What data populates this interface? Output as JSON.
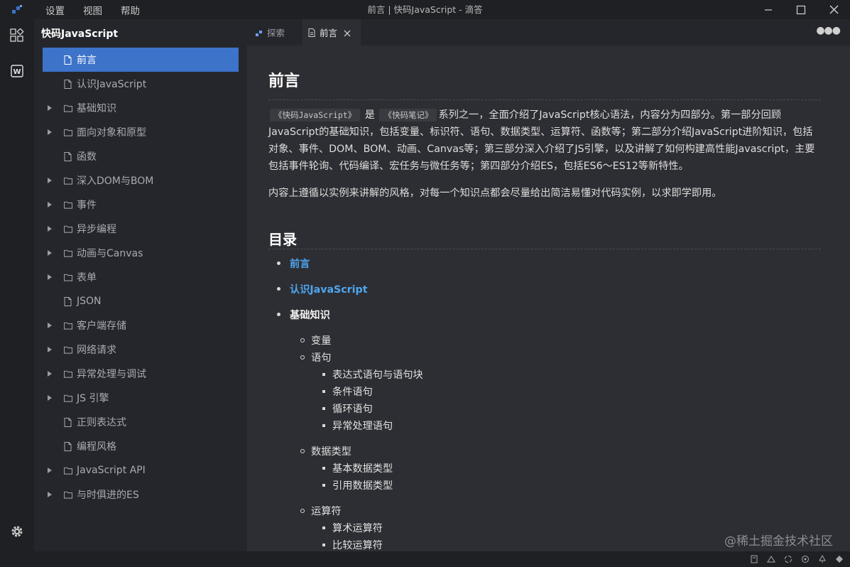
{
  "window": {
    "title": "前言 | 快码JavaScript - 滴答",
    "menu": [
      "设置",
      "视图",
      "帮助"
    ]
  },
  "sidebar": {
    "title": "快码JavaScript",
    "items": [
      {
        "label": "前言",
        "folder": false,
        "active": true
      },
      {
        "label": "认识JavaScript",
        "folder": false
      },
      {
        "label": "基础知识",
        "folder": true
      },
      {
        "label": "面向对象和原型",
        "folder": true
      },
      {
        "label": "函数",
        "folder": false
      },
      {
        "label": "深入DOM与BOM",
        "folder": true
      },
      {
        "label": "事件",
        "folder": true
      },
      {
        "label": "异步编程",
        "folder": true
      },
      {
        "label": "动画与Canvas",
        "folder": true
      },
      {
        "label": "表单",
        "folder": true
      },
      {
        "label": "JSON",
        "folder": false
      },
      {
        "label": "客户端存储",
        "folder": true
      },
      {
        "label": "网络请求",
        "folder": true
      },
      {
        "label": "异常处理与调试",
        "folder": true
      },
      {
        "label": "JS 引擎",
        "folder": true
      },
      {
        "label": "正则表达式",
        "folder": false
      },
      {
        "label": "编程风格",
        "folder": false
      },
      {
        "label": "JavaScript API",
        "folder": true
      },
      {
        "label": "与时俱进的ES",
        "folder": true
      }
    ]
  },
  "tabs": {
    "explore": "探索",
    "current": "前言"
  },
  "doc": {
    "title": "前言",
    "code1": "《快码JavaScript》",
    "is": "是",
    "code2": "《快码笔记》",
    "intro_rest": "系列之一，全面介绍了JavaScript核心语法，内容分为四部分。第一部分回顾JavaScript的基础知识，包括变量、标识符、语句、数据类型、运算符、函数等；第二部分介绍JavaScript进阶知识，包括对象、事件、DOM、BOM、动画、Canvas等；第三部分深入介绍了JS引擎，以及讲解了如何构建高性能Javascript，主要包括事件轮询、代码编译、宏任务与微任务等；第四部分介绍ES，包括ES6～ES12等新特性。",
    "para2": "内容上遵循以实例来讲解的风格，对每一个知识点都会尽量给出简洁易懂对代码实例，以求即学即用。",
    "toc_title": "目录",
    "toc": {
      "l1": [
        "前言",
        "认识JavaScript",
        "基础知识"
      ],
      "vars": "变量",
      "stmts": "语句",
      "stmt_children": [
        "表达式语句与语句块",
        "条件语句",
        "循环语句",
        "异常处理语句"
      ],
      "types": "数据类型",
      "type_children": [
        "基本数据类型",
        "引用数据类型"
      ],
      "ops": "运算符",
      "op_children": [
        "算术运算符",
        "比较运算符"
      ]
    }
  },
  "watermark": "@稀土掘金技术社区",
  "colors": {
    "accent": "#3d73c9",
    "link": "#4ea6f0"
  }
}
